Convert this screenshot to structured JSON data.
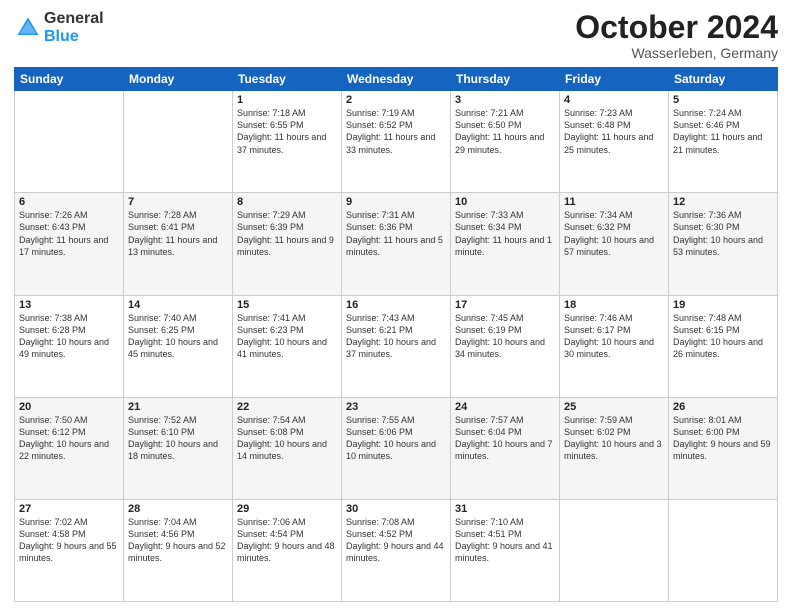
{
  "header": {
    "logo": {
      "general": "General",
      "blue": "Blue"
    },
    "title": "October 2024",
    "location": "Wasserleben, Germany"
  },
  "weekdays": [
    "Sunday",
    "Monday",
    "Tuesday",
    "Wednesday",
    "Thursday",
    "Friday",
    "Saturday"
  ],
  "weeks": [
    [
      {
        "day": "",
        "sunrise": "",
        "sunset": "",
        "daylight": ""
      },
      {
        "day": "",
        "sunrise": "",
        "sunset": "",
        "daylight": ""
      },
      {
        "day": "1",
        "sunrise": "Sunrise: 7:18 AM",
        "sunset": "Sunset: 6:55 PM",
        "daylight": "Daylight: 11 hours and 37 minutes."
      },
      {
        "day": "2",
        "sunrise": "Sunrise: 7:19 AM",
        "sunset": "Sunset: 6:52 PM",
        "daylight": "Daylight: 11 hours and 33 minutes."
      },
      {
        "day": "3",
        "sunrise": "Sunrise: 7:21 AM",
        "sunset": "Sunset: 6:50 PM",
        "daylight": "Daylight: 11 hours and 29 minutes."
      },
      {
        "day": "4",
        "sunrise": "Sunrise: 7:23 AM",
        "sunset": "Sunset: 6:48 PM",
        "daylight": "Daylight: 11 hours and 25 minutes."
      },
      {
        "day": "5",
        "sunrise": "Sunrise: 7:24 AM",
        "sunset": "Sunset: 6:46 PM",
        "daylight": "Daylight: 11 hours and 21 minutes."
      }
    ],
    [
      {
        "day": "6",
        "sunrise": "Sunrise: 7:26 AM",
        "sunset": "Sunset: 6:43 PM",
        "daylight": "Daylight: 11 hours and 17 minutes."
      },
      {
        "day": "7",
        "sunrise": "Sunrise: 7:28 AM",
        "sunset": "Sunset: 6:41 PM",
        "daylight": "Daylight: 11 hours and 13 minutes."
      },
      {
        "day": "8",
        "sunrise": "Sunrise: 7:29 AM",
        "sunset": "Sunset: 6:39 PM",
        "daylight": "Daylight: 11 hours and 9 minutes."
      },
      {
        "day": "9",
        "sunrise": "Sunrise: 7:31 AM",
        "sunset": "Sunset: 6:36 PM",
        "daylight": "Daylight: 11 hours and 5 minutes."
      },
      {
        "day": "10",
        "sunrise": "Sunrise: 7:33 AM",
        "sunset": "Sunset: 6:34 PM",
        "daylight": "Daylight: 11 hours and 1 minute."
      },
      {
        "day": "11",
        "sunrise": "Sunrise: 7:34 AM",
        "sunset": "Sunset: 6:32 PM",
        "daylight": "Daylight: 10 hours and 57 minutes."
      },
      {
        "day": "12",
        "sunrise": "Sunrise: 7:36 AM",
        "sunset": "Sunset: 6:30 PM",
        "daylight": "Daylight: 10 hours and 53 minutes."
      }
    ],
    [
      {
        "day": "13",
        "sunrise": "Sunrise: 7:38 AM",
        "sunset": "Sunset: 6:28 PM",
        "daylight": "Daylight: 10 hours and 49 minutes."
      },
      {
        "day": "14",
        "sunrise": "Sunrise: 7:40 AM",
        "sunset": "Sunset: 6:25 PM",
        "daylight": "Daylight: 10 hours and 45 minutes."
      },
      {
        "day": "15",
        "sunrise": "Sunrise: 7:41 AM",
        "sunset": "Sunset: 6:23 PM",
        "daylight": "Daylight: 10 hours and 41 minutes."
      },
      {
        "day": "16",
        "sunrise": "Sunrise: 7:43 AM",
        "sunset": "Sunset: 6:21 PM",
        "daylight": "Daylight: 10 hours and 37 minutes."
      },
      {
        "day": "17",
        "sunrise": "Sunrise: 7:45 AM",
        "sunset": "Sunset: 6:19 PM",
        "daylight": "Daylight: 10 hours and 34 minutes."
      },
      {
        "day": "18",
        "sunrise": "Sunrise: 7:46 AM",
        "sunset": "Sunset: 6:17 PM",
        "daylight": "Daylight: 10 hours and 30 minutes."
      },
      {
        "day": "19",
        "sunrise": "Sunrise: 7:48 AM",
        "sunset": "Sunset: 6:15 PM",
        "daylight": "Daylight: 10 hours and 26 minutes."
      }
    ],
    [
      {
        "day": "20",
        "sunrise": "Sunrise: 7:50 AM",
        "sunset": "Sunset: 6:12 PM",
        "daylight": "Daylight: 10 hours and 22 minutes."
      },
      {
        "day": "21",
        "sunrise": "Sunrise: 7:52 AM",
        "sunset": "Sunset: 6:10 PM",
        "daylight": "Daylight: 10 hours and 18 minutes."
      },
      {
        "day": "22",
        "sunrise": "Sunrise: 7:54 AM",
        "sunset": "Sunset: 6:08 PM",
        "daylight": "Daylight: 10 hours and 14 minutes."
      },
      {
        "day": "23",
        "sunrise": "Sunrise: 7:55 AM",
        "sunset": "Sunset: 6:06 PM",
        "daylight": "Daylight: 10 hours and 10 minutes."
      },
      {
        "day": "24",
        "sunrise": "Sunrise: 7:57 AM",
        "sunset": "Sunset: 6:04 PM",
        "daylight": "Daylight: 10 hours and 7 minutes."
      },
      {
        "day": "25",
        "sunrise": "Sunrise: 7:59 AM",
        "sunset": "Sunset: 6:02 PM",
        "daylight": "Daylight: 10 hours and 3 minutes."
      },
      {
        "day": "26",
        "sunrise": "Sunrise: 8:01 AM",
        "sunset": "Sunset: 6:00 PM",
        "daylight": "Daylight: 9 hours and 59 minutes."
      }
    ],
    [
      {
        "day": "27",
        "sunrise": "Sunrise: 7:02 AM",
        "sunset": "Sunset: 4:58 PM",
        "daylight": "Daylight: 9 hours and 55 minutes."
      },
      {
        "day": "28",
        "sunrise": "Sunrise: 7:04 AM",
        "sunset": "Sunset: 4:56 PM",
        "daylight": "Daylight: 9 hours and 52 minutes."
      },
      {
        "day": "29",
        "sunrise": "Sunrise: 7:06 AM",
        "sunset": "Sunset: 4:54 PM",
        "daylight": "Daylight: 9 hours and 48 minutes."
      },
      {
        "day": "30",
        "sunrise": "Sunrise: 7:08 AM",
        "sunset": "Sunset: 4:52 PM",
        "daylight": "Daylight: 9 hours and 44 minutes."
      },
      {
        "day": "31",
        "sunrise": "Sunrise: 7:10 AM",
        "sunset": "Sunset: 4:51 PM",
        "daylight": "Daylight: 9 hours and 41 minutes."
      },
      {
        "day": "",
        "sunrise": "",
        "sunset": "",
        "daylight": ""
      },
      {
        "day": "",
        "sunrise": "",
        "sunset": "",
        "daylight": ""
      }
    ]
  ]
}
